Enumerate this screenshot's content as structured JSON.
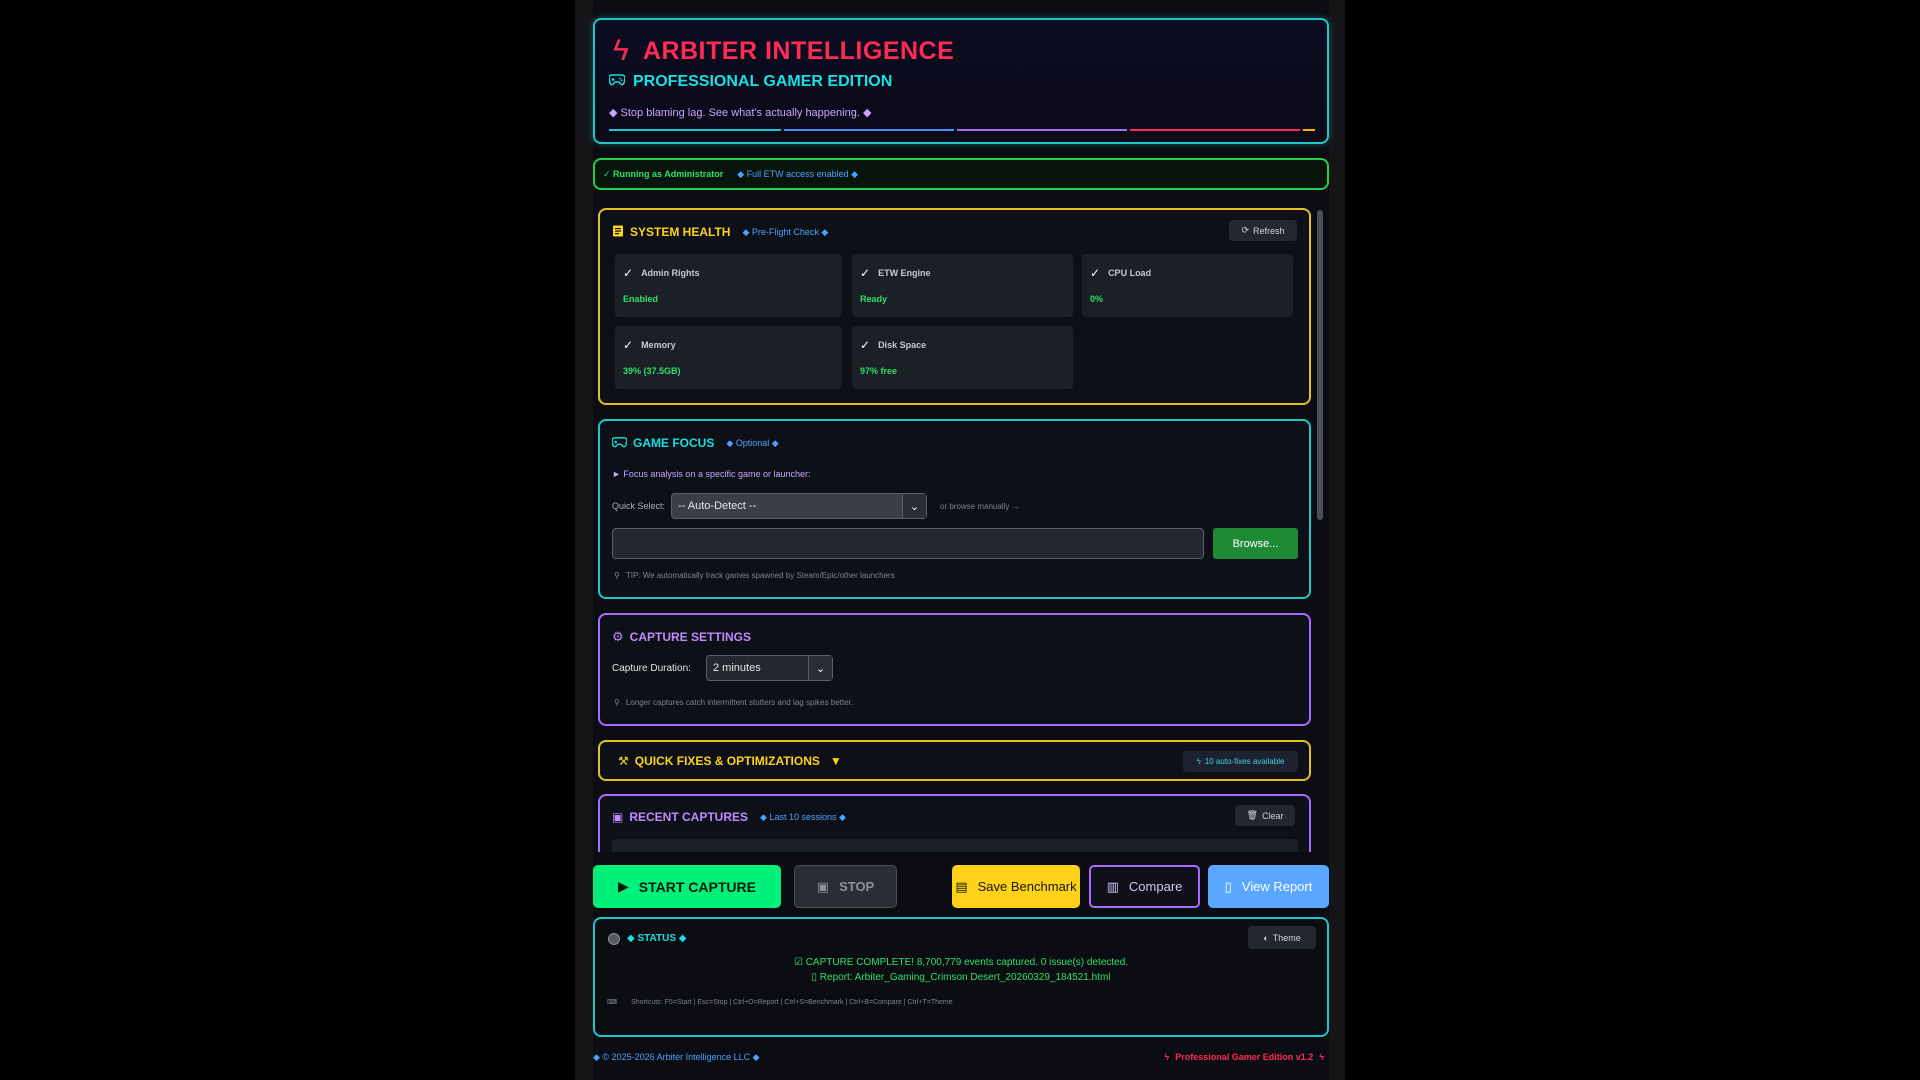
{
  "header": {
    "title": "ARBITER INTELLIGENCE",
    "subtitle": "PROFESSIONAL GAMER EDITION",
    "tagline": "◆ Stop blaming lag. See what's actually happening. ◆",
    "bar_colors": [
      "#1ec8c8",
      "#4a8cff",
      "#a66bff",
      "#ff2b55",
      "#ffb000"
    ]
  },
  "admin_banner": {
    "status": "✓ Running as Administrator",
    "etw": "◆ Full ETW access enabled ◆"
  },
  "system_health": {
    "title": "SYSTEM HEALTH",
    "note": "◆ Pre-Flight Check ◆",
    "refresh_label": "Refresh",
    "checks": [
      {
        "label": "Admin Rights",
        "value": "Enabled"
      },
      {
        "label": "ETW Engine",
        "value": "Ready"
      },
      {
        "label": "CPU Load",
        "value": "0%"
      },
      {
        "label": "Memory",
        "value": "39% (37.5GB)"
      },
      {
        "label": "Disk Space",
        "value": "97% free"
      }
    ]
  },
  "game_focus": {
    "title": "GAME FOCUS",
    "note": "◆ Optional ◆",
    "description": "► Focus analysis on a specific game or launcher:",
    "quick_select_label": "Quick Select:",
    "quick_select_value": "-- Auto-Detect --",
    "browse_hint": "or browse manually →",
    "path_value": "",
    "browse_label": "Browse...",
    "tip": "TIP: We automatically track games spawned by Steam/Epic/other launchers"
  },
  "capture_settings": {
    "title": "CAPTURE SETTINGS",
    "duration_label": "Capture Duration:",
    "duration_value": "2 minutes",
    "tip": "Longer captures catch intermittent stutters and lag spikes better."
  },
  "quick_fixes": {
    "title": "QUICK FIXES & OPTIMIZATIONS",
    "caret": "▼",
    "badge": "10 auto-fixes available"
  },
  "recent_captures": {
    "title": "RECENT CAPTURES",
    "note": "◆ Last 10 sessions ◆",
    "clear_label": "Clear"
  },
  "actions": {
    "start": "START CAPTURE",
    "stop": "STOP",
    "save": "Save Benchmark",
    "compare": "Compare",
    "report": "View Report"
  },
  "status": {
    "title": "◆ STATUS ◆",
    "theme_label": "Theme",
    "line1": "CAPTURE COMPLETE! 8,700,779 events captured. 0 issue(s) detected.",
    "line2": "Report: Arbiter_Gaming_Crimson Desert_20260329_184521.html",
    "shortcuts": "Shortcuts: F5=Start | Esc=Stop | Ctrl+O=Report | Ctrl+S=Benchmark | Ctrl+B=Compare | Ctrl+T=Theme"
  },
  "footer": {
    "copyright": "◆ © 2025-2026 Arbiter Intelligence LLC ◆",
    "edition": "Professional Gamer Edition v1.2"
  }
}
